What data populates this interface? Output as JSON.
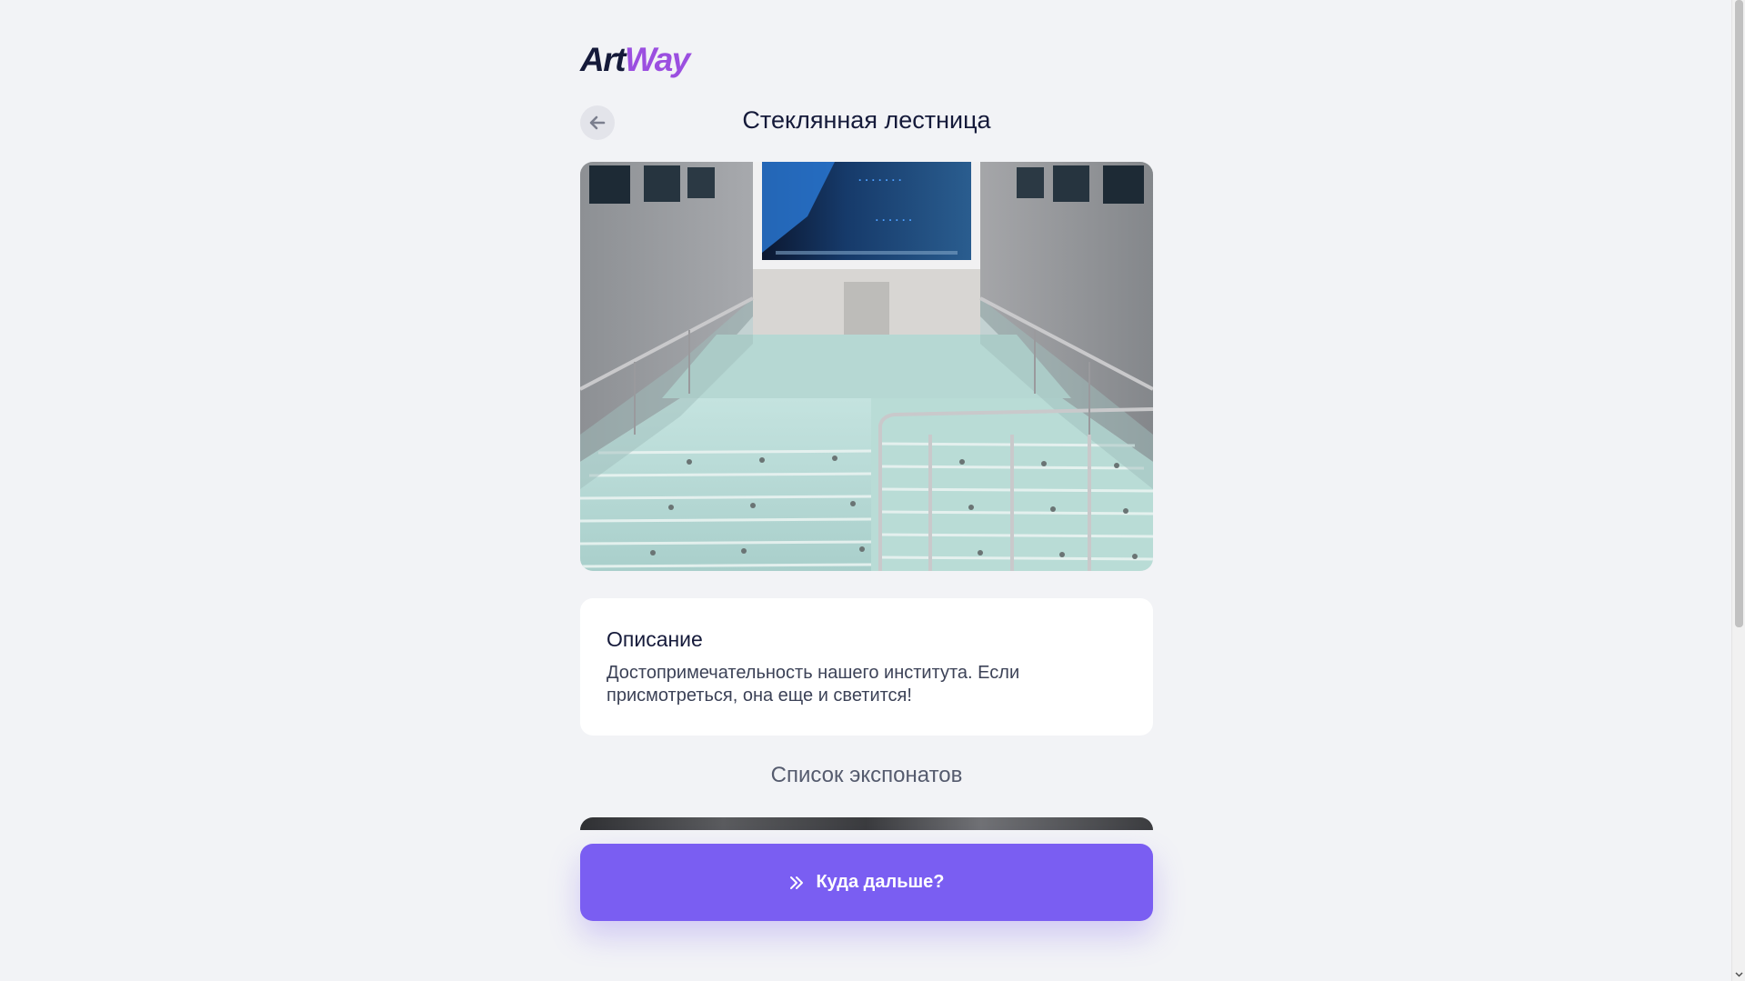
{
  "brand": {
    "logo_part1": "Art",
    "logo_part2": "Way",
    "logo_color_dark": "#151a3a",
    "logo_color_accent": "#9b4fe0"
  },
  "header": {
    "title": "Стеклянная лестница",
    "back_icon": "arrow-left-icon"
  },
  "hero": {
    "image": "glass-staircase-photo"
  },
  "description": {
    "title": "Описание",
    "text": "Достопримечательность нашего института. Если присмотреться, она еще и светится!"
  },
  "exhibits": {
    "title": "Список экспонатов"
  },
  "action": {
    "next_label": "Куда дальше?",
    "next_icon": "double-chevron-right-icon",
    "color": "#7a5ef2"
  }
}
